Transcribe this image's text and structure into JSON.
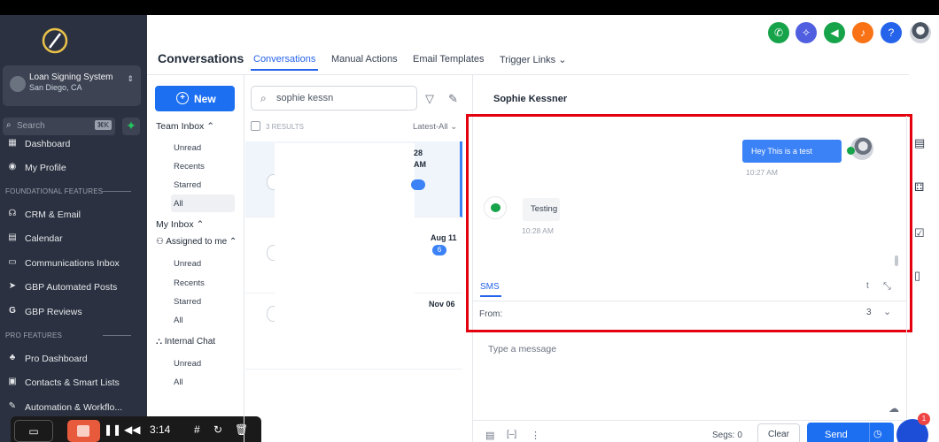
{
  "sidebar": {
    "account": {
      "name": "Loan Signing System",
      "location": "San Diego, CA"
    },
    "search": {
      "placeholder": "Search",
      "shortcut": "⌘K"
    },
    "items_top": [
      {
        "label": "Dashboard",
        "icon": "dashboard-icon"
      },
      {
        "label": "My Profile",
        "icon": "profile-icon"
      }
    ],
    "section_foundational": "FOUNDATIONAL FEATURES",
    "items_foundational": [
      {
        "label": "CRM & Email",
        "icon": "crm-icon"
      },
      {
        "label": "Calendar",
        "icon": "calendar-icon"
      },
      {
        "label": "Communications Inbox",
        "icon": "inbox-icon"
      },
      {
        "label": "GBP Automated Posts",
        "icon": "send-icon"
      },
      {
        "label": "GBP Reviews",
        "icon": "google-icon"
      }
    ],
    "section_pro": "PRO FEATURES",
    "items_pro": [
      {
        "label": "Pro Dashboard",
        "icon": "pro-dashboard-icon"
      },
      {
        "label": "Contacts & Smart Lists",
        "icon": "contacts-icon"
      },
      {
        "label": "Automation & Workflo...",
        "icon": "automation-icon"
      }
    ]
  },
  "recorder": {
    "time": "3:14"
  },
  "header": {
    "title": "Conversations",
    "tabs": [
      "Conversations",
      "Manual Actions",
      "Email Templates",
      "Trigger Links"
    ]
  },
  "inbox": {
    "new_label": "New",
    "team_inbox": "Team Inbox",
    "team_items": [
      "Unread",
      "Recents",
      "Starred",
      "All"
    ],
    "my_inbox": "My Inbox",
    "assigned": "Assigned to me",
    "assigned_items": [
      "Unread",
      "Recents",
      "Starred",
      "All"
    ],
    "internal_chat": "Internal Chat",
    "internal_items": [
      "Unread",
      "All"
    ]
  },
  "conv_list": {
    "search_value": "sophie kessn",
    "results": "3 RESULTS",
    "sort": "Latest-All",
    "row1_date_a": "28",
    "row1_date_b": "AM",
    "row2_date": "Aug 11",
    "row2_badge": "6",
    "row3_date": "Nov 06"
  },
  "chat": {
    "contact": "Sophie Kessner",
    "outgoing_text": "Hey This is a test",
    "outgoing_time": "10:27 AM",
    "incoming_text": "Testing",
    "incoming_time": "10:28 AM",
    "channel_tab": "SMS",
    "from_label": "From:",
    "from_value": "3",
    "compose_placeholder": "Type a message",
    "segs": "Segs: 0",
    "clear_label": "Clear",
    "send_label": "Send"
  },
  "fab_badge": "1",
  "colors": {
    "accent": "#1d6ff2",
    "highlight_box": "#e3000f",
    "sidebar_bg": "#2b3140"
  }
}
